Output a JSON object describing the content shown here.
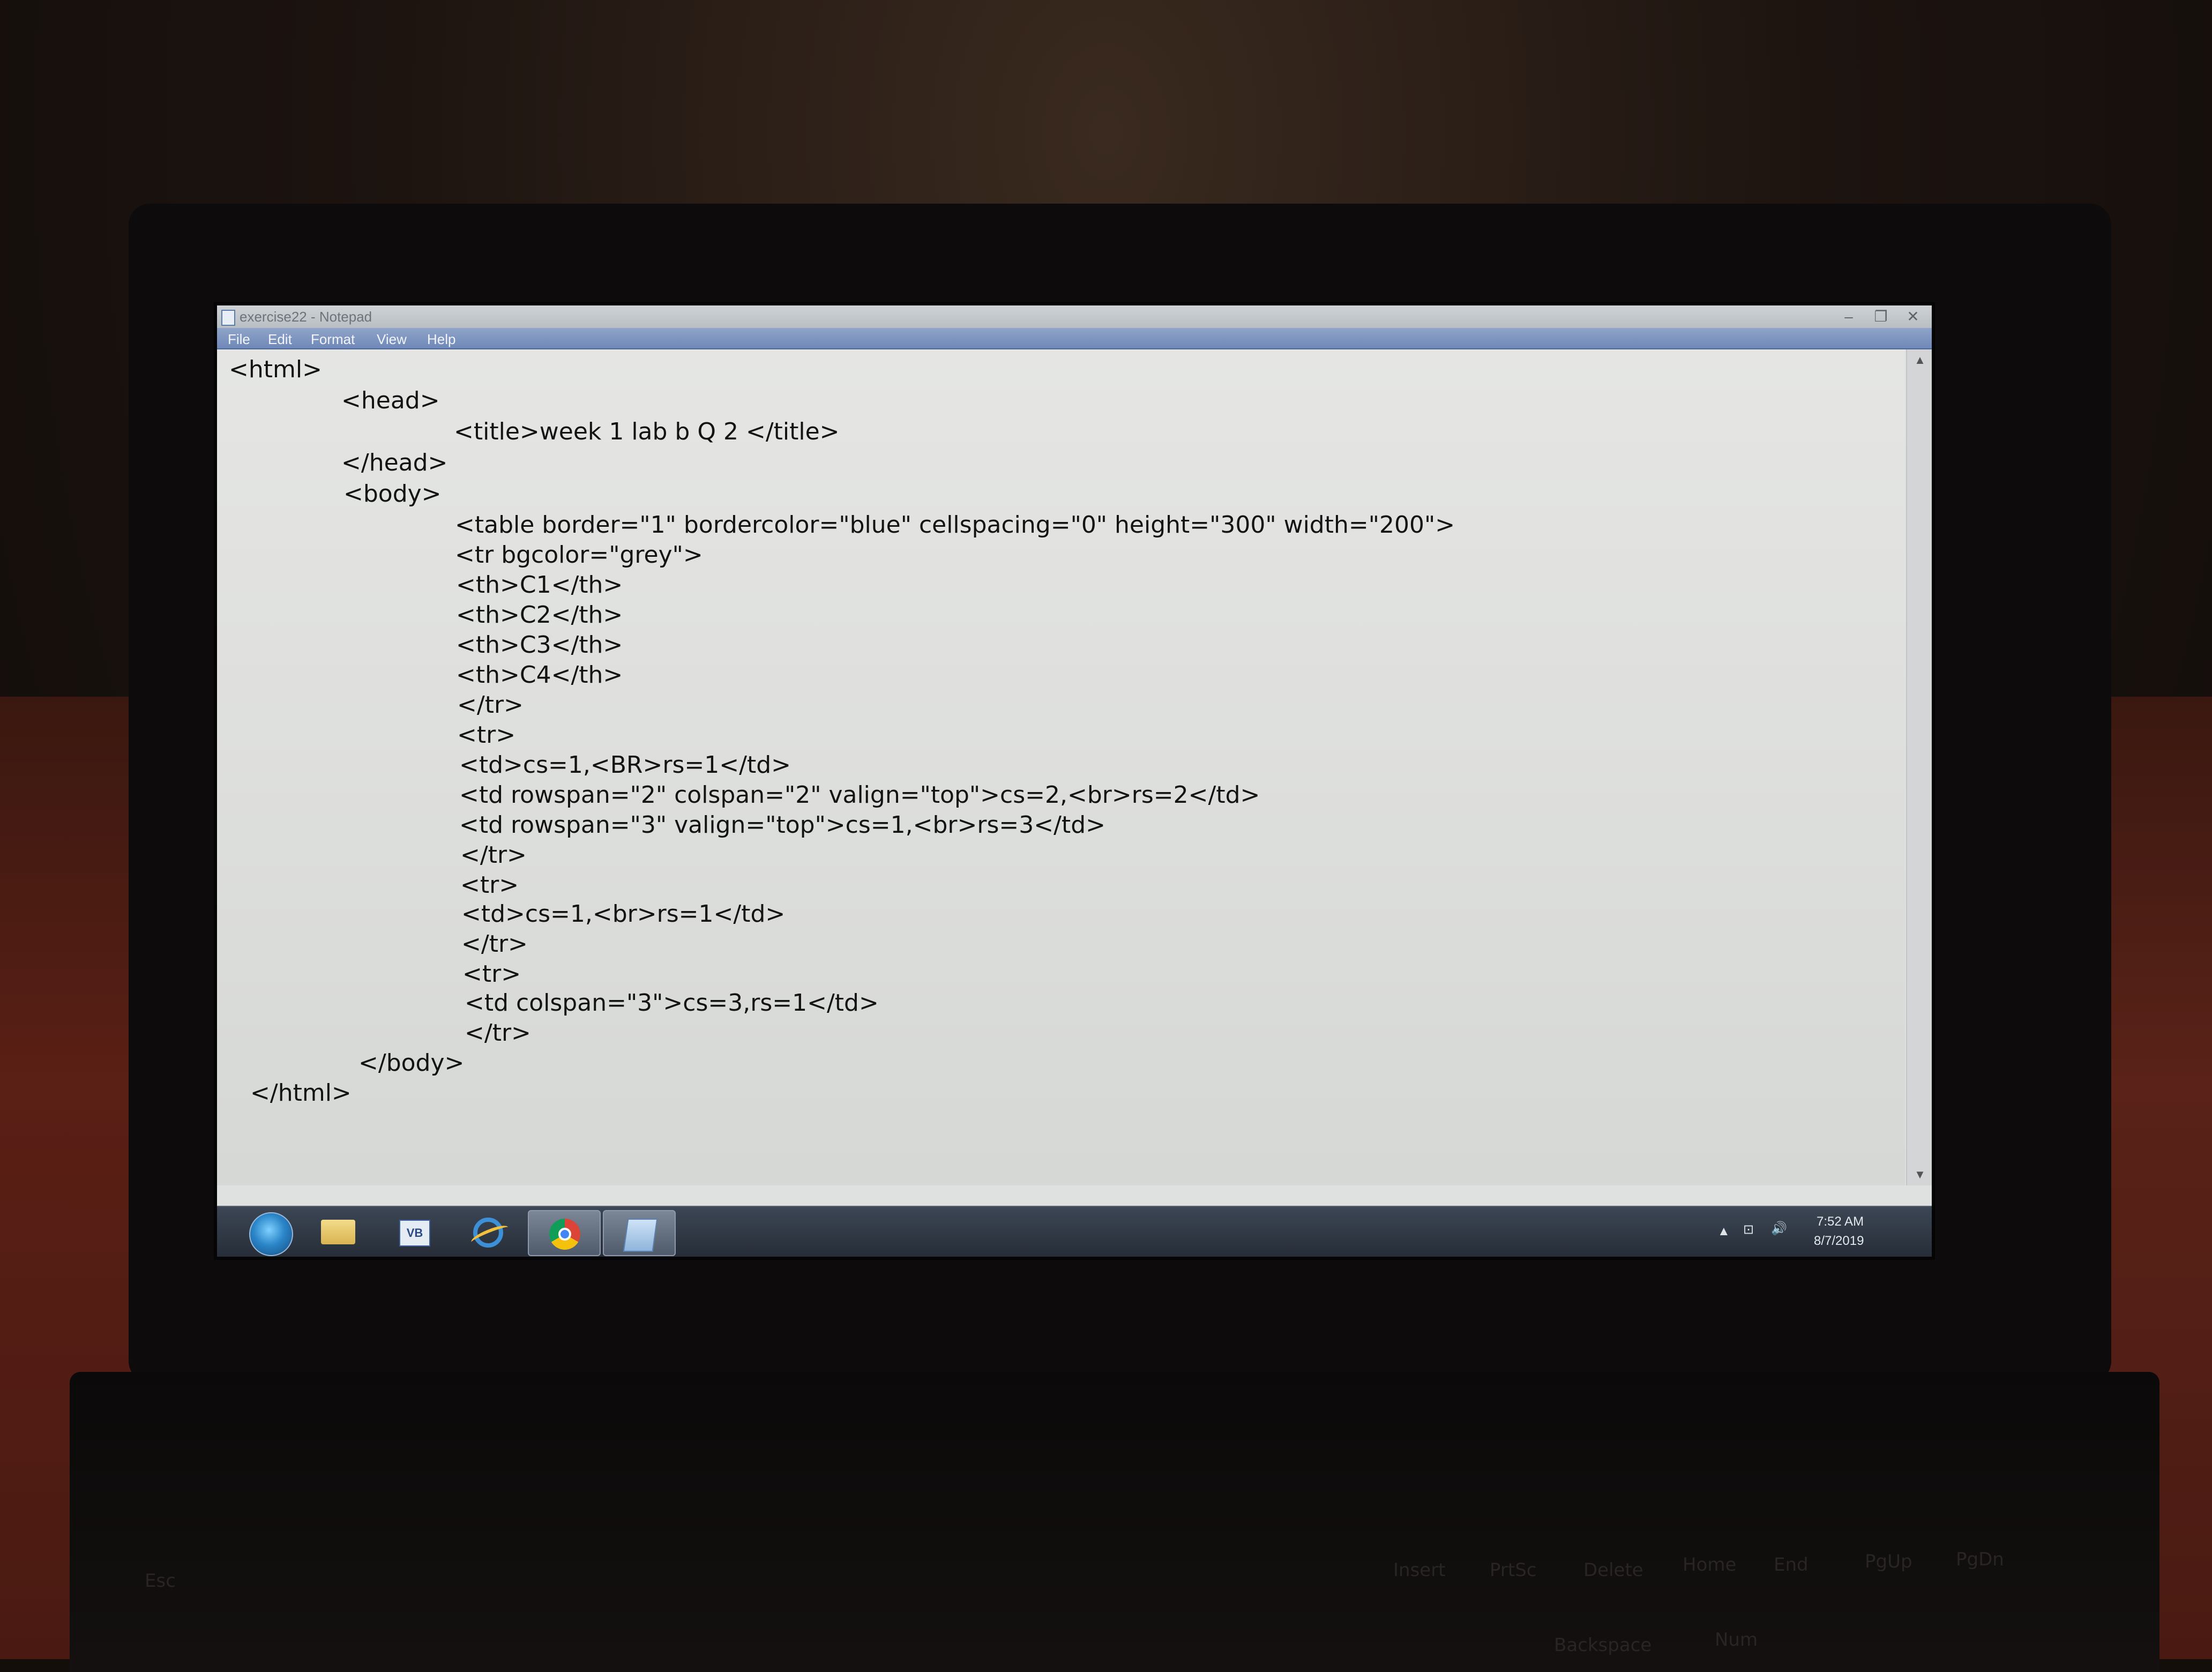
{
  "window": {
    "title": "exercise22 - Notepad",
    "buttons": [
      "–",
      "❐",
      "✕"
    ]
  },
  "menu": [
    "File",
    "Edit",
    "Format",
    "View",
    "Help"
  ],
  "editor_lines": [
    "<html>",
    "<head>",
    "<title>week 1 lab b Q 2 </title>",
    "</head>",
    "<body>",
    "<table border=\"1\" bordercolor=\"blue\" cellspacing=\"0\" height=\"300\" width=\"200\">",
    "<tr bgcolor=\"grey\">",
    "<th>C1</th>",
    "<th>C2</th>",
    "<th>C3</th>",
    "<th>C4</th>",
    "</tr>",
    "<tr>",
    "<td>cs=1,<BR>rs=1</td>",
    "<td rowspan=\"2\" colspan=\"2\" valign=\"top\">cs=2,<br>rs=2</td>",
    "<td rowspan=\"3\" valign=\"top\">cs=1,<br>rs=3</td>",
    "</tr>",
    "<tr>",
    "<td>cs=1,<br>rs=1</td>",
    "</tr>",
    "<tr>",
    "<td colspan=\"3\">cs=3,rs=1</td>",
    "</tr>",
    "</body>",
    "</html>"
  ],
  "taskbar": {
    "items": [
      "start-orb",
      "folder-icon",
      "vb-icon",
      "ie-icon",
      "chrome-icon",
      "notepad-icon"
    ],
    "vb_label": "VB",
    "tray_arrow": "▲",
    "tray_network": "⊡",
    "tray_volume": "🔊",
    "time": "7:52 AM",
    "date": "8/7/2019"
  },
  "keyboard_labels": [
    "Esc",
    "Insert",
    "PrtSc",
    "Delete",
    "Home",
    "End",
    "PgUp",
    "PgDn",
    "Backspace",
    "Num"
  ]
}
